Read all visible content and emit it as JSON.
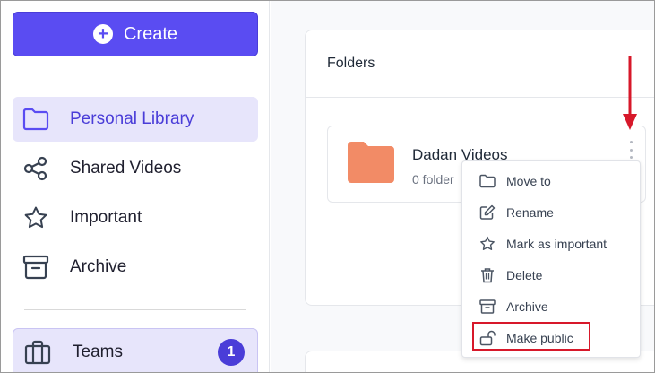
{
  "sidebar": {
    "create_label": "Create",
    "items": [
      {
        "label": "Personal Library",
        "icon": "folder-icon",
        "active": true
      },
      {
        "label": "Shared Videos",
        "icon": "share-icon",
        "active": false
      },
      {
        "label": "Important",
        "icon": "star-icon",
        "active": false
      },
      {
        "label": "Archive",
        "icon": "archive-icon",
        "active": false
      }
    ],
    "teams": {
      "label": "Teams",
      "badge": "1",
      "icon": "briefcase-icon"
    }
  },
  "main": {
    "section_title": "Folders",
    "folder": {
      "name": "Dadan Videos",
      "meta": "0 folder",
      "color": "#f28b66"
    }
  },
  "menu": {
    "items": [
      {
        "label": "Move to",
        "icon": "folder-icon"
      },
      {
        "label": "Rename",
        "icon": "edit-icon"
      },
      {
        "label": "Mark as important",
        "icon": "star-icon"
      },
      {
        "label": "Delete",
        "icon": "trash-icon"
      },
      {
        "label": "Archive",
        "icon": "archive-icon"
      },
      {
        "label": "Make public",
        "icon": "unlock-icon"
      }
    ]
  },
  "colors": {
    "accent": "#5a4cf2",
    "active_bg": "#e7e5fb",
    "annotation": "#d7182a"
  }
}
